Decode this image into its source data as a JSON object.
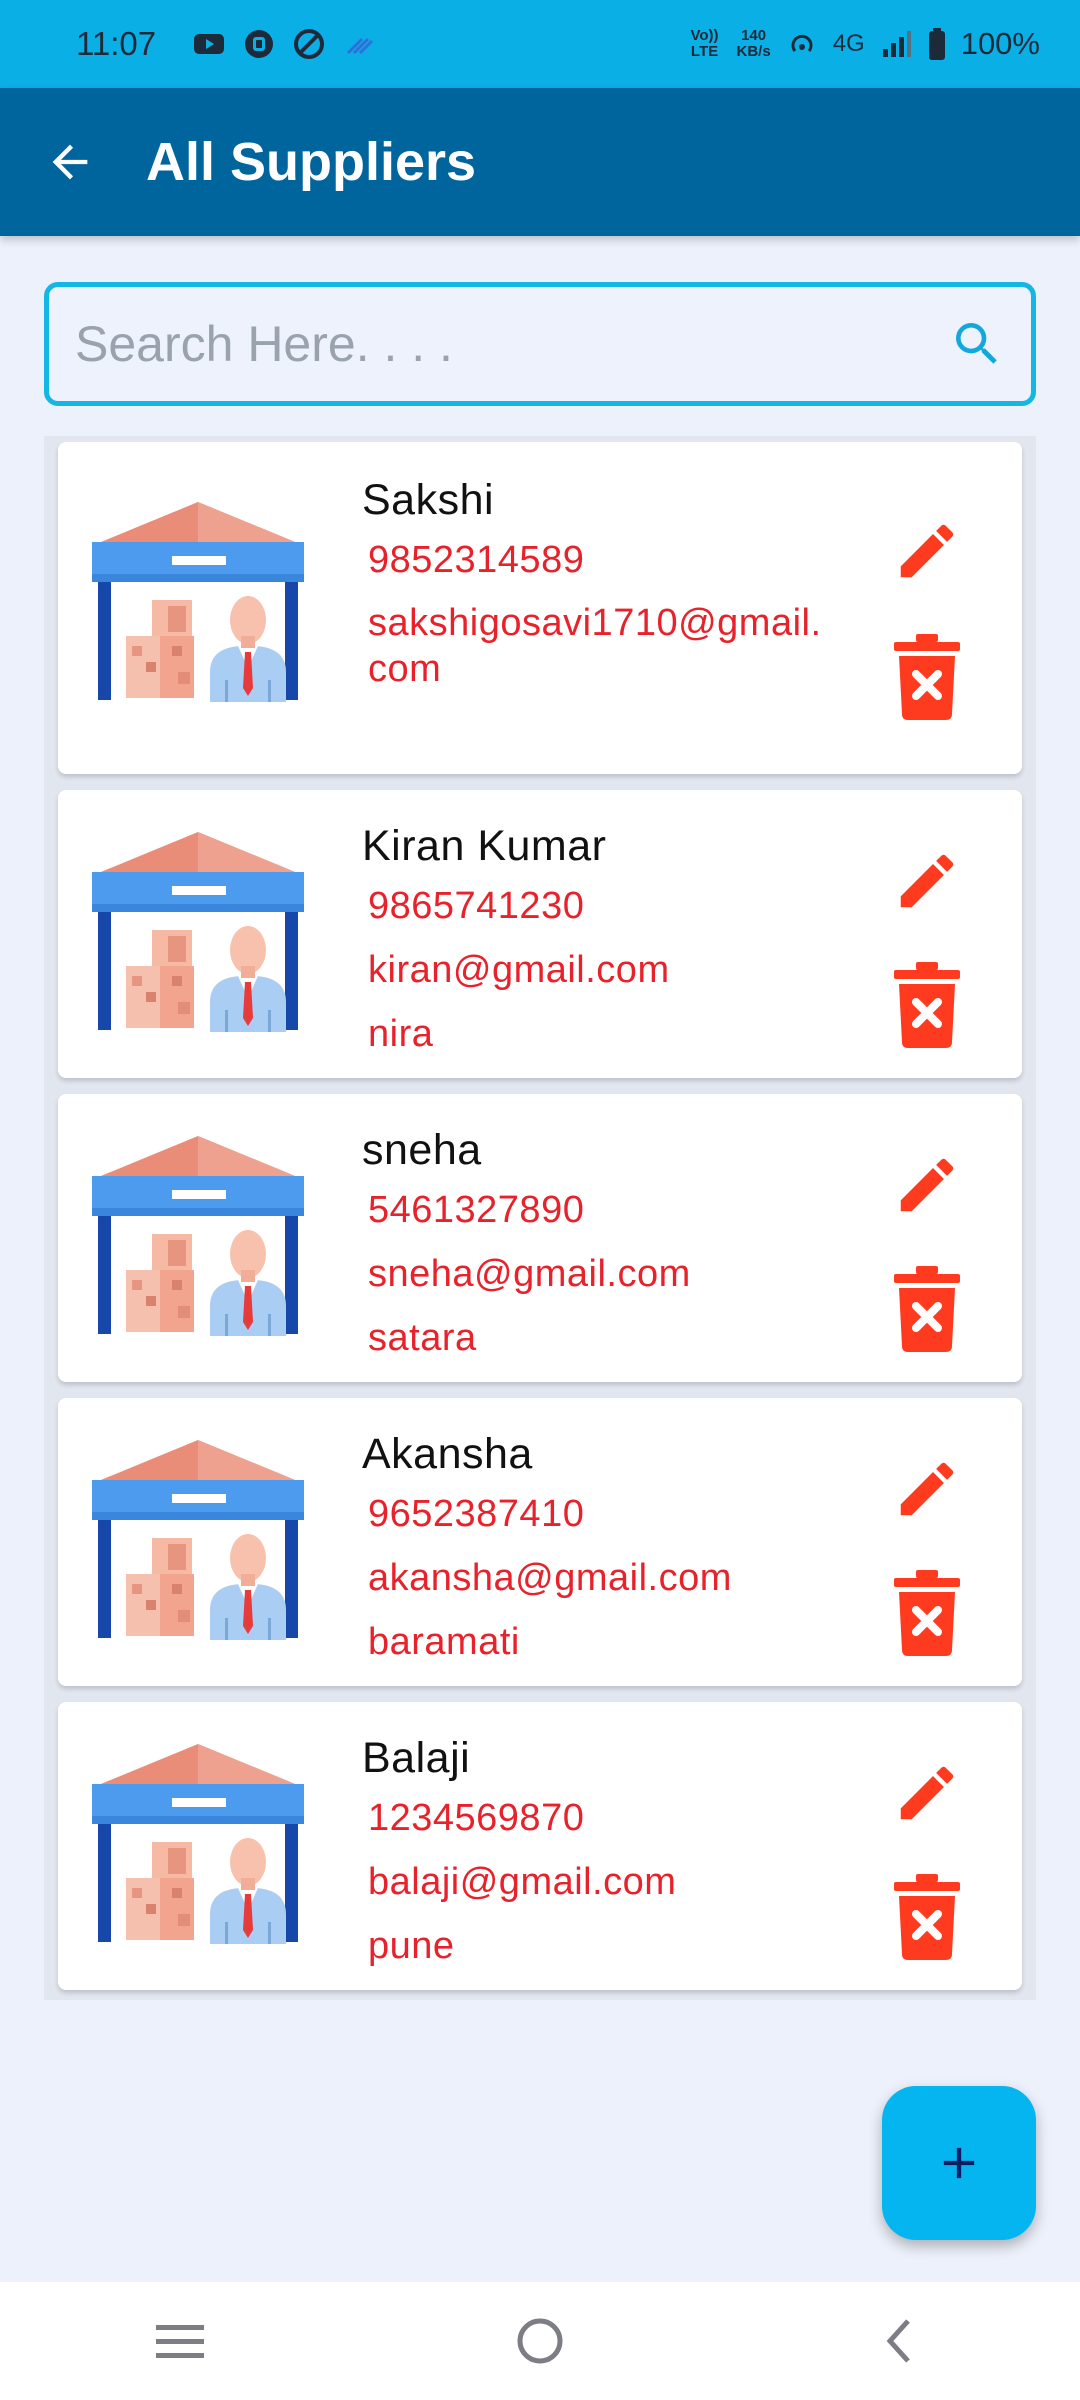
{
  "status_bar": {
    "time": "11:07",
    "volte": "Vo)) LTE",
    "speed_value": "140",
    "speed_unit": "KB/s",
    "network": "4G",
    "battery": "100%"
  },
  "app_bar": {
    "title": "All Suppliers",
    "back_icon": "arrow-left-icon"
  },
  "search": {
    "placeholder": "Search Here. . . .",
    "value": "",
    "icon": "search-icon"
  },
  "suppliers": [
    {
      "name": "Sakshi",
      "phone": "9852314589",
      "email": "sakshigosavi1710@gmail.com",
      "address": ""
    },
    {
      "name": "Kiran Kumar",
      "phone": "9865741230",
      "email": "kiran@gmail.com",
      "address": "nira"
    },
    {
      "name": "sneha",
      "phone": "5461327890",
      "email": "sneha@gmail.com",
      "address": "satara"
    },
    {
      "name": "Akansha",
      "phone": "9652387410",
      "email": "akansha@gmail.com",
      "address": "baramati"
    },
    {
      "name": "Balaji",
      "phone": "1234569870",
      "email": "balaji@gmail.com",
      "address": "pune"
    }
  ],
  "fab": {
    "icon": "plus-icon"
  },
  "nav_bar": {
    "icons": [
      "menu-icon",
      "home-circle-icon",
      "back-chevron-icon"
    ]
  },
  "colors": {
    "status_bar": "#0AAFE6",
    "app_bar": "#01659D",
    "accent": "#14B6E6",
    "detail_text": "#E8222B",
    "action_icons": "#FF3B1F",
    "fab": "#05B5EF",
    "background": "#EDF1FB"
  }
}
